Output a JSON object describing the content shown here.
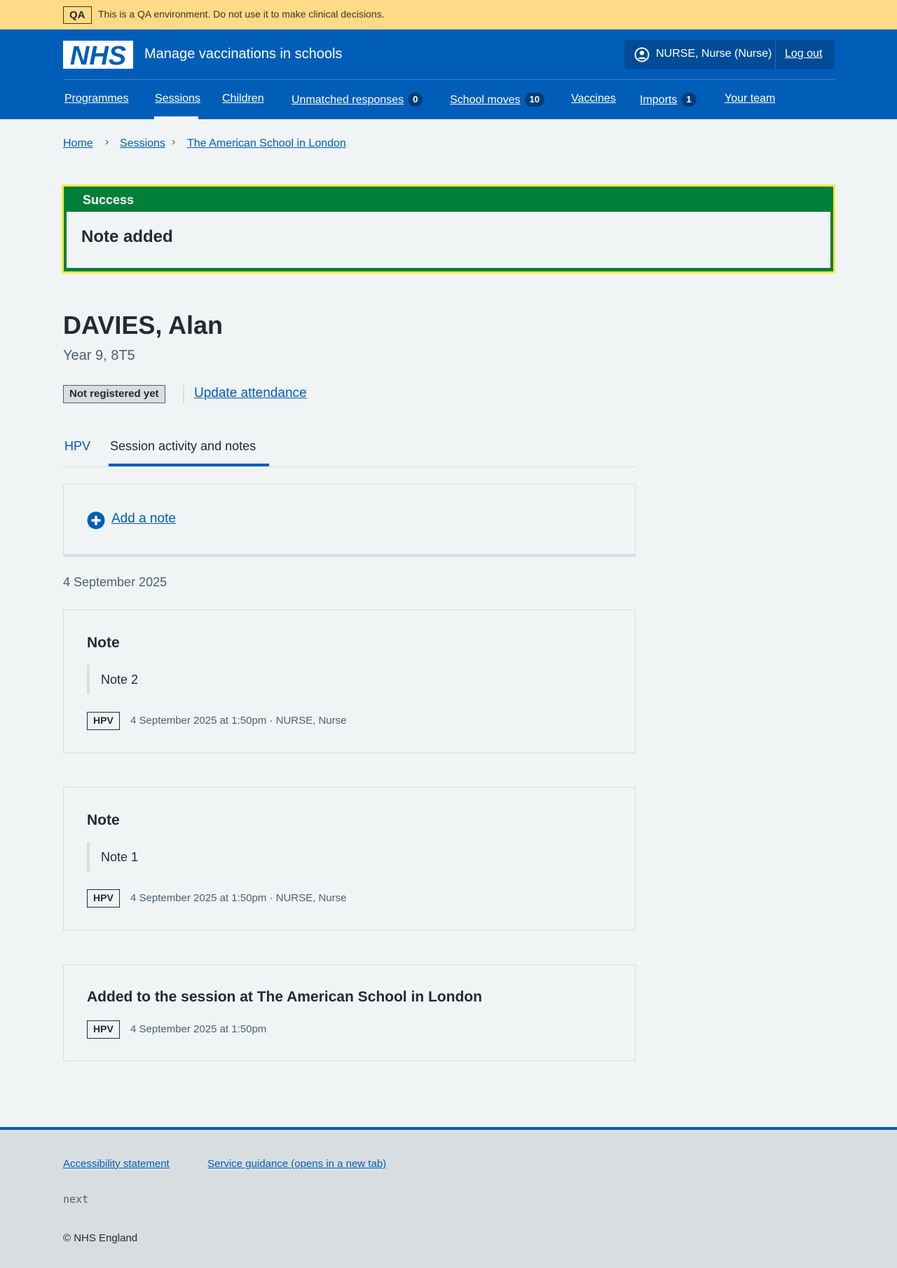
{
  "qa_banner": {
    "tag": "QA",
    "text": "This is a QA environment. Do not use it to make clinical decisions."
  },
  "header": {
    "logo": "NHS",
    "service_name": "Manage vaccinations in schools",
    "account_name": "NURSE, Nurse (Nurse)",
    "logout": "Log out"
  },
  "nav": [
    {
      "label": "Programmes",
      "badge": ""
    },
    {
      "label": "Sessions",
      "badge": "",
      "active": true
    },
    {
      "label": "Children",
      "badge": ""
    },
    {
      "label": "Unmatched responses",
      "badge": "0"
    },
    {
      "label": "School moves",
      "badge": "10"
    },
    {
      "label": "Vaccines",
      "badge": ""
    },
    {
      "label": "Imports",
      "badge": "1"
    },
    {
      "label": "Your team",
      "badge": ""
    }
  ],
  "breadcrumbs": [
    "Home",
    "Sessions",
    "The American School in London"
  ],
  "success": {
    "title": "Success",
    "message": "Note added"
  },
  "patient": {
    "name": "DAVIES, Alan",
    "subtitle": "Year 9, 8T5",
    "status": "Not registered yet",
    "update_link": "Update attendance"
  },
  "tabs": [
    "HPV",
    "Session activity and notes"
  ],
  "add_note": "Add a note",
  "date_heading": "4 September 2025",
  "activities": [
    {
      "title": "Note",
      "body": "Note 2",
      "tag": "HPV",
      "meta": "4 September 2025 at 1:50pm · NURSE, Nurse"
    },
    {
      "title": "Note",
      "body": "Note 1",
      "tag": "HPV",
      "meta": "4 September 2025 at 1:50pm · NURSE, Nurse"
    },
    {
      "title": "Added to the session at The American School in London",
      "tag": "HPV",
      "meta": "4 September 2025 at 1:50pm"
    }
  ],
  "footer": {
    "links": [
      "Accessibility statement",
      "Service guidance (opens in a new tab)"
    ],
    "build": "next",
    "copyright": "© NHS England"
  },
  "colors": {
    "nhs_blue": "#005eb8",
    "success_green": "#007f3b",
    "qa_yellow": "#ffdb87",
    "focus_yellow": "#ffeb3b"
  }
}
